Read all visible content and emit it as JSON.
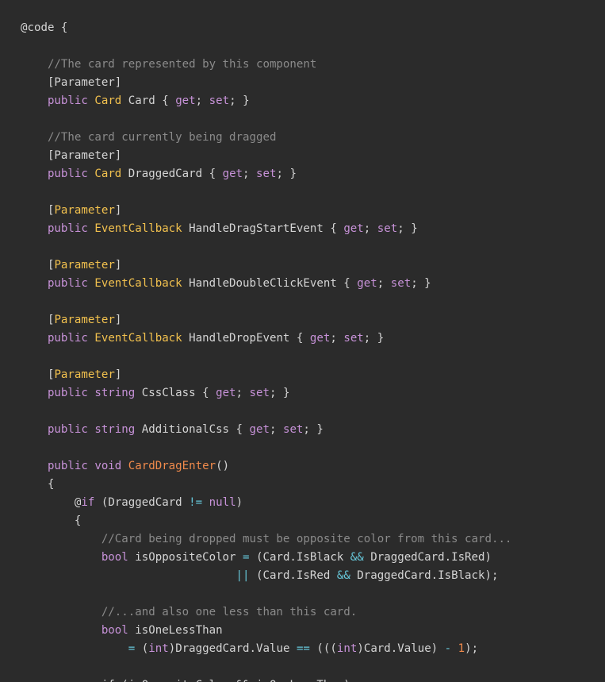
{
  "colors": {
    "background": "#2b2b2b",
    "plain": "#d4d4d4",
    "comment": "#8a8a8a",
    "keyword": "#c792d8",
    "type": "#f2c14e",
    "method": "#f08a4b",
    "operator": "#66c6d8",
    "number": "#f08a4b"
  },
  "code": {
    "lines": [
      [
        {
          "t": "@code {",
          "k": "plain"
        }
      ],
      [],
      [
        {
          "t": "    //The card represented by this component",
          "k": "comment"
        }
      ],
      [
        {
          "t": "    [Parameter]",
          "k": "plain"
        }
      ],
      [
        {
          "t": "    public ",
          "k": "keyword"
        },
        {
          "t": "Card",
          "k": "type"
        },
        {
          "t": " Card { ",
          "k": "plain"
        },
        {
          "t": "get",
          "k": "keyword"
        },
        {
          "t": "; ",
          "k": "plain"
        },
        {
          "t": "set",
          "k": "keyword"
        },
        {
          "t": "; }",
          "k": "plain"
        }
      ],
      [],
      [
        {
          "t": "    //The card currently being dragged",
          "k": "comment"
        }
      ],
      [
        {
          "t": "    [Parameter]",
          "k": "plain"
        }
      ],
      [
        {
          "t": "    public ",
          "k": "keyword"
        },
        {
          "t": "Card",
          "k": "type"
        },
        {
          "t": " DraggedCard { ",
          "k": "plain"
        },
        {
          "t": "get",
          "k": "keyword"
        },
        {
          "t": "; ",
          "k": "plain"
        },
        {
          "t": "set",
          "k": "keyword"
        },
        {
          "t": "; }",
          "k": "plain"
        }
      ],
      [],
      [
        {
          "t": "    [",
          "k": "plain"
        },
        {
          "t": "Parameter",
          "k": "attribute"
        },
        {
          "t": "]",
          "k": "plain"
        }
      ],
      [
        {
          "t": "    public ",
          "k": "keyword"
        },
        {
          "t": "EventCallback",
          "k": "type"
        },
        {
          "t": " HandleDragStartEvent { ",
          "k": "plain"
        },
        {
          "t": "get",
          "k": "keyword"
        },
        {
          "t": "; ",
          "k": "plain"
        },
        {
          "t": "set",
          "k": "keyword"
        },
        {
          "t": "; }",
          "k": "plain"
        }
      ],
      [],
      [
        {
          "t": "    [",
          "k": "plain"
        },
        {
          "t": "Parameter",
          "k": "attribute"
        },
        {
          "t": "]",
          "k": "plain"
        }
      ],
      [
        {
          "t": "    public ",
          "k": "keyword"
        },
        {
          "t": "EventCallback",
          "k": "type"
        },
        {
          "t": " HandleDoubleClickEvent { ",
          "k": "plain"
        },
        {
          "t": "get",
          "k": "keyword"
        },
        {
          "t": "; ",
          "k": "plain"
        },
        {
          "t": "set",
          "k": "keyword"
        },
        {
          "t": "; }",
          "k": "plain"
        }
      ],
      [],
      [
        {
          "t": "    [",
          "k": "plain"
        },
        {
          "t": "Parameter",
          "k": "attribute"
        },
        {
          "t": "]",
          "k": "plain"
        }
      ],
      [
        {
          "t": "    public ",
          "k": "keyword"
        },
        {
          "t": "EventCallback",
          "k": "type"
        },
        {
          "t": " HandleDropEvent { ",
          "k": "plain"
        },
        {
          "t": "get",
          "k": "keyword"
        },
        {
          "t": "; ",
          "k": "plain"
        },
        {
          "t": "set",
          "k": "keyword"
        },
        {
          "t": "; }",
          "k": "plain"
        }
      ],
      [],
      [
        {
          "t": "    [",
          "k": "plain"
        },
        {
          "t": "Parameter",
          "k": "attribute"
        },
        {
          "t": "]",
          "k": "plain"
        }
      ],
      [
        {
          "t": "    public string",
          "k": "keyword"
        },
        {
          "t": " CssClass { ",
          "k": "plain"
        },
        {
          "t": "get",
          "k": "keyword"
        },
        {
          "t": "; ",
          "k": "plain"
        },
        {
          "t": "set",
          "k": "keyword"
        },
        {
          "t": "; }",
          "k": "plain"
        }
      ],
      [],
      [
        {
          "t": "    public string",
          "k": "keyword"
        },
        {
          "t": " AdditionalCss { ",
          "k": "plain"
        },
        {
          "t": "get",
          "k": "keyword"
        },
        {
          "t": "; ",
          "k": "plain"
        },
        {
          "t": "set",
          "k": "keyword"
        },
        {
          "t": "; }",
          "k": "plain"
        }
      ],
      [],
      [
        {
          "t": "    public void ",
          "k": "keyword"
        },
        {
          "t": "CardDragEnter",
          "k": "method"
        },
        {
          "t": "()",
          "k": "plain"
        }
      ],
      [
        {
          "t": "    {",
          "k": "plain"
        }
      ],
      [
        {
          "t": "        @",
          "k": "plain"
        },
        {
          "t": "if",
          "k": "keyword"
        },
        {
          "t": " (DraggedCard ",
          "k": "plain"
        },
        {
          "t": "!=",
          "k": "operator"
        },
        {
          "t": " ",
          "k": "plain"
        },
        {
          "t": "null",
          "k": "keyword"
        },
        {
          "t": ")",
          "k": "plain"
        }
      ],
      [
        {
          "t": "        {",
          "k": "plain"
        }
      ],
      [
        {
          "t": "            //Card being dropped must be opposite color from this card...",
          "k": "comment"
        }
      ],
      [
        {
          "t": "            bool",
          "k": "keyword"
        },
        {
          "t": " isOppositeColor ",
          "k": "plain"
        },
        {
          "t": "=",
          "k": "operator"
        },
        {
          "t": " (Card.IsBlack ",
          "k": "plain"
        },
        {
          "t": "&&",
          "k": "operator"
        },
        {
          "t": " DraggedCard.IsRed)",
          "k": "plain"
        }
      ],
      [
        {
          "t": "                                ",
          "k": "plain"
        },
        {
          "t": "||",
          "k": "operator"
        },
        {
          "t": " (Card.IsRed ",
          "k": "plain"
        },
        {
          "t": "&&",
          "k": "operator"
        },
        {
          "t": " DraggedCard.IsBlack);",
          "k": "plain"
        }
      ],
      [],
      [
        {
          "t": "            //...and also one less than this card.",
          "k": "comment"
        }
      ],
      [
        {
          "t": "            bool",
          "k": "keyword"
        },
        {
          "t": " isOneLessThan",
          "k": "plain"
        }
      ],
      [
        {
          "t": "                ",
          "k": "plain"
        },
        {
          "t": "=",
          "k": "operator"
        },
        {
          "t": " (",
          "k": "plain"
        },
        {
          "t": "int",
          "k": "keyword"
        },
        {
          "t": ")DraggedCard.Value ",
          "k": "plain"
        },
        {
          "t": "==",
          "k": "operator"
        },
        {
          "t": " (((",
          "k": "plain"
        },
        {
          "t": "int",
          "k": "keyword"
        },
        {
          "t": ")Card.Value) ",
          "k": "plain"
        },
        {
          "t": "-",
          "k": "operator"
        },
        {
          "t": " ",
          "k": "plain"
        },
        {
          "t": "1",
          "k": "number"
        },
        {
          "t": ");",
          "k": "plain"
        }
      ],
      [],
      [
        {
          "t": "            if (isOppositeColor && isOneLessThan)",
          "k": "plain"
        }
      ]
    ]
  }
}
